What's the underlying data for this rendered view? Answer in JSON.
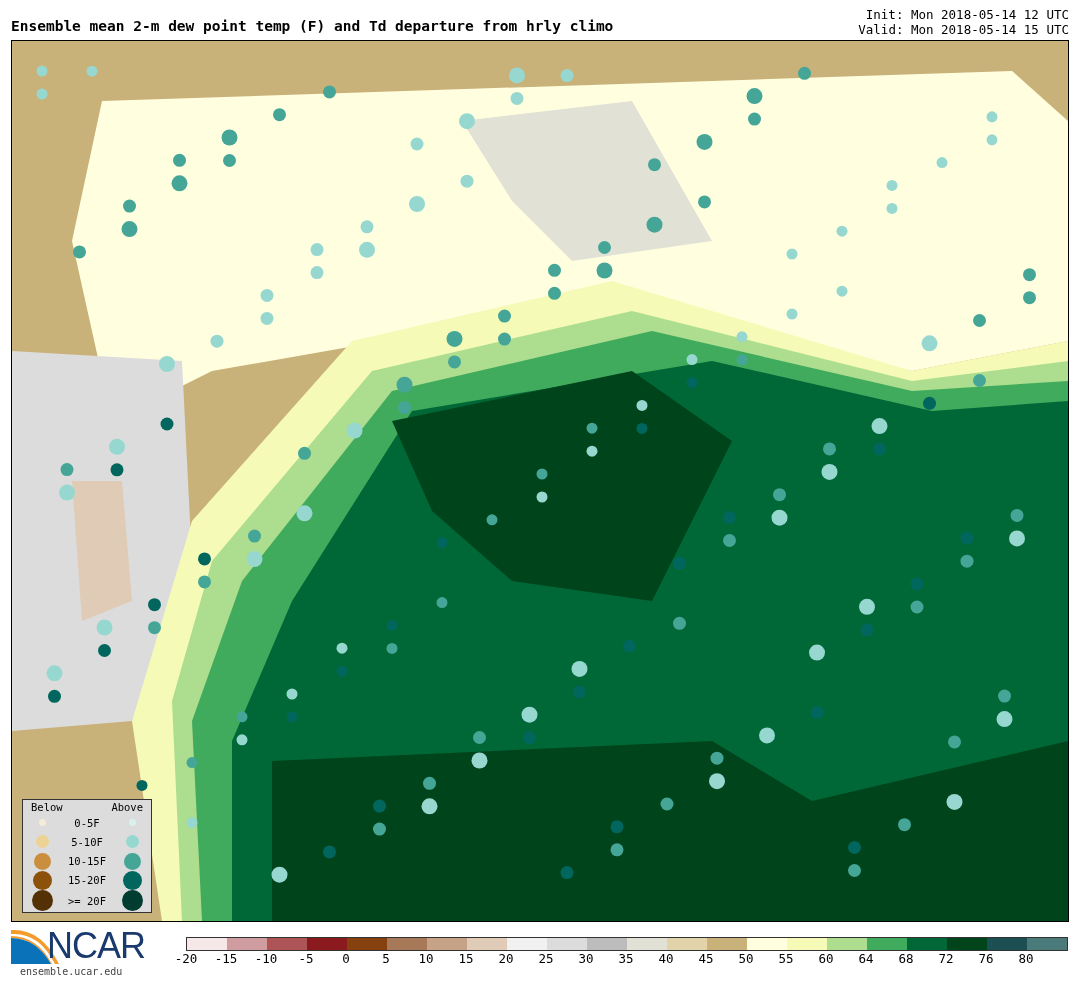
{
  "title": "Ensemble mean 2-m dew point temp (F) and Td departure from hrly climo",
  "init": "Init: Mon 2018-05-14 12 UTC",
  "valid": "Valid: Mon 2018-05-14 15 UTC",
  "legend": {
    "below_label": "Below",
    "above_label": "Above",
    "rows": [
      {
        "label": "0-5F",
        "dots": [
          {
            "color": "#f5ecd6"
          },
          {
            "color": "#d8f0ee"
          }
        ]
      },
      {
        "label": "5-10F",
        "dots": [
          {
            "color": "#ecd395"
          },
          {
            "color": "#96d8d0"
          }
        ]
      },
      {
        "label": "10-15F",
        "dots": [
          {
            "color": "#c98f3e"
          },
          {
            "color": "#45a698"
          }
        ]
      },
      {
        "label": "15-20F",
        "dots": [
          {
            "color": "#8c510a"
          },
          {
            "color": "#01665e"
          }
        ]
      },
      {
        "label": ">= 20F",
        "dots": [
          {
            "color": "#543005"
          },
          {
            "color": "#003c30"
          }
        ]
      }
    ]
  },
  "logo": {
    "name": "NCAR",
    "url": "ensemble.ucar.edu"
  },
  "colorbar": {
    "segments": [
      {
        "color": "#f6e8e8"
      },
      {
        "color": "#cf9da0"
      },
      {
        "color": "#ad5457"
      },
      {
        "color": "#8b1a1e"
      },
      {
        "color": "#864110"
      },
      {
        "color": "#a87958"
      },
      {
        "color": "#c6a386"
      },
      {
        "color": "#e0cbb7"
      },
      {
        "color": "#f1f1f1"
      },
      {
        "color": "#dcdcdc"
      },
      {
        "color": "#bcbcbc"
      },
      {
        "color": "#e1e1d5"
      },
      {
        "color": "#e2d3aa"
      },
      {
        "color": "#c9b27a"
      },
      {
        "color": "#ffffe0"
      },
      {
        "color": "#f5fbb6"
      },
      {
        "color": "#addd8e"
      },
      {
        "color": "#41ab5d"
      },
      {
        "color": "#006837"
      },
      {
        "color": "#00441b"
      },
      {
        "color": "#1b4f52"
      },
      {
        "color": "#4a7a7a"
      }
    ],
    "ticks": [
      "-20",
      "-15",
      "-10",
      "-5",
      "0",
      "5",
      "10",
      "15",
      "20",
      "25",
      "30",
      "35",
      "40",
      "45",
      "50",
      "55",
      "60",
      "64",
      "68",
      "72",
      "76",
      "80"
    ]
  }
}
